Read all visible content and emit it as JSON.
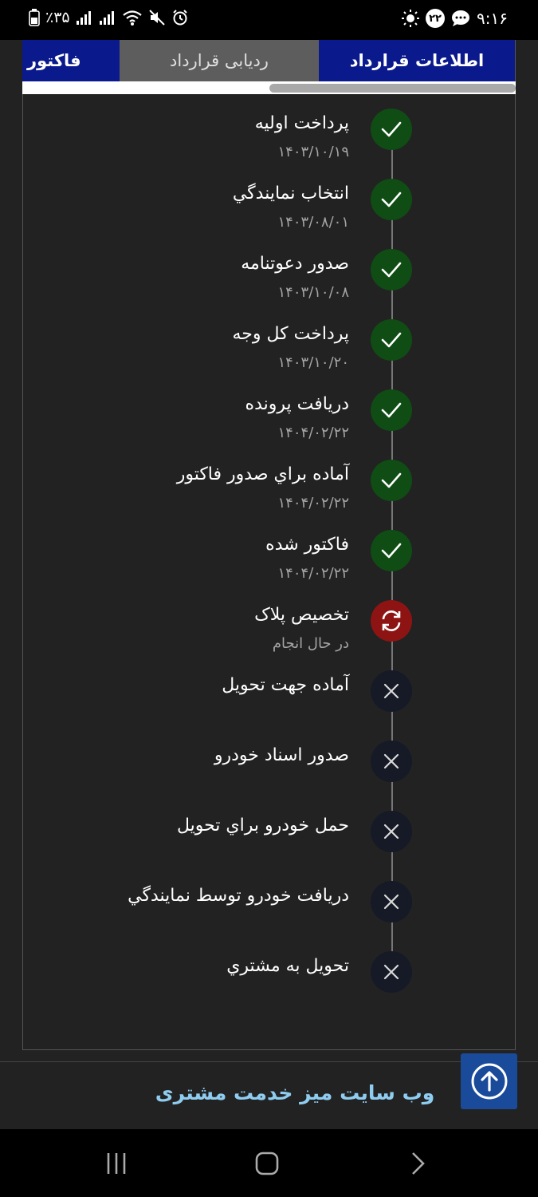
{
  "status_bar": {
    "time": "۹:۱۶",
    "notification_count": "۲۲",
    "battery_text": "٪۳۵"
  },
  "tabs": [
    {
      "label": "اطلاعات قرارداد",
      "state": "active"
    },
    {
      "label": "ردیابی قرارداد",
      "state": "selected"
    },
    {
      "label": "فاکتور",
      "state": "active"
    }
  ],
  "steps": [
    {
      "title": "پرداخت اولیه",
      "subtitle": "۱۴۰۳/۱۰/۱۹",
      "status": "done",
      "icon": "check-icon"
    },
    {
      "title": "انتخاب نمايندگي",
      "subtitle": "۱۴۰۳/۰۸/۰۱",
      "status": "done",
      "icon": "check-icon"
    },
    {
      "title": "صدور دعوتنامه",
      "subtitle": "۱۴۰۳/۱۰/۰۸",
      "status": "done",
      "icon": "check-icon"
    },
    {
      "title": "پرداخت کل وجه",
      "subtitle": "۱۴۰۳/۱۰/۲۰",
      "status": "done",
      "icon": "check-icon"
    },
    {
      "title": "دريافت پرونده",
      "subtitle": "۱۴۰۴/۰۲/۲۲",
      "status": "done",
      "icon": "check-icon"
    },
    {
      "title": "آماده براي صدور فاکتور",
      "subtitle": "۱۴۰۴/۰۲/۲۲",
      "status": "done",
      "icon": "check-icon"
    },
    {
      "title": "فاکتور شده",
      "subtitle": "۱۴۰۴/۰۲/۲۲",
      "status": "done",
      "icon": "check-icon"
    },
    {
      "title": "تخصيص پلاک",
      "subtitle": "در حال انجام",
      "status": "active",
      "icon": "sync-icon"
    },
    {
      "title": "آماده جهت تحويل",
      "subtitle": "",
      "status": "pending",
      "icon": "close-icon"
    },
    {
      "title": "صدور اسناد خودرو",
      "subtitle": "",
      "status": "pending",
      "icon": "close-icon"
    },
    {
      "title": "حمل خودرو براي تحويل",
      "subtitle": "",
      "status": "pending",
      "icon": "close-icon"
    },
    {
      "title": "دريافت خودرو توسط نمايندگي",
      "subtitle": "",
      "status": "pending",
      "icon": "close-icon"
    },
    {
      "title": "تحويل به مشتري",
      "subtitle": "",
      "status": "pending",
      "icon": "close-icon"
    }
  ],
  "footer": {
    "link_text": "وب سایت میز خدمت مشتری"
  },
  "colors": {
    "tab_blue": "#0a1a8c",
    "done_green": "#0f4d14",
    "active_red": "#8e1414",
    "pending_dark": "#151a26",
    "link_blue": "#8fcdf0"
  }
}
